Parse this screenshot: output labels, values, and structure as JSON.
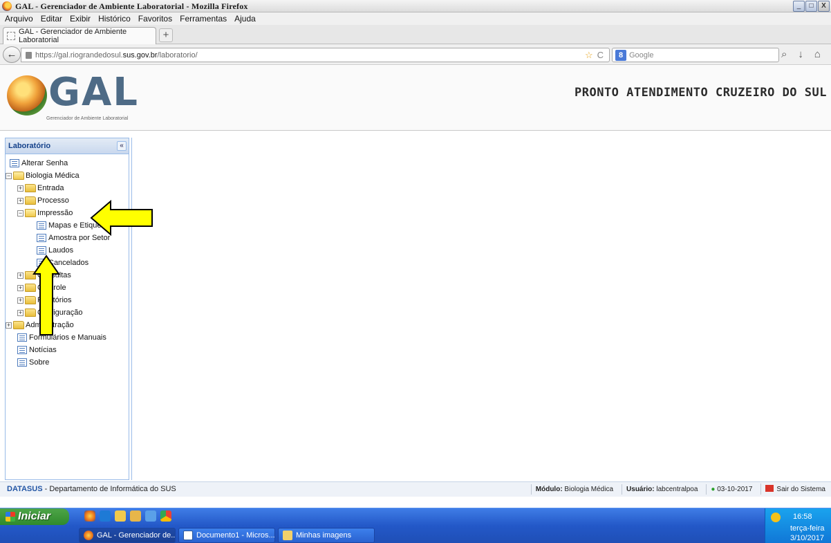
{
  "window": {
    "title": "GAL - Gerenciador de Ambiente Laboratorial - Mozilla Firefox",
    "controls": [
      "_",
      "□",
      "X"
    ]
  },
  "menu": [
    "Arquivo",
    "Editar",
    "Exibir",
    "Histórico",
    "Favoritos",
    "Ferramentas",
    "Ajuda"
  ],
  "tab": {
    "label": "GAL - Gerenciador de Ambiente Laboratorial",
    "new": "+"
  },
  "nav": {
    "back": "←",
    "url_prefix": "https://gal.riograndedosul.",
    "url_host": "sus.gov.br",
    "url_path": "/laboratorio/",
    "search_placeholder": "Google",
    "search_engine": "8",
    "reload": "C",
    "download": "↓",
    "home": "⌂",
    "bookmark": "☆",
    "search": "⌕"
  },
  "header": {
    "logo_text": "GAL",
    "logo_subtitle": "Gerenciador de Ambiente Laboratorial",
    "unit_name": "PRONTO ATENDIMENTO CRUZEIRO DO SUL"
  },
  "sidebar": {
    "title": "Laboratório",
    "collapse": "«",
    "items": [
      {
        "label": "Alterar Senha",
        "type": "leaf"
      },
      {
        "label": "Biologia Médica",
        "type": "folder-open"
      },
      {
        "label": "Entrada",
        "type": "folder"
      },
      {
        "label": "Processo",
        "type": "folder"
      },
      {
        "label": "Impressão",
        "type": "folder-open"
      },
      {
        "label": "Mapas e Etiquetas",
        "type": "leaf"
      },
      {
        "label": "Amostra por Setor",
        "type": "leaf"
      },
      {
        "label": "Laudos",
        "type": "leaf"
      },
      {
        "label": "Cancelados",
        "type": "leaf"
      },
      {
        "label": "Consultas",
        "type": "folder"
      },
      {
        "label": "Controle",
        "type": "folder"
      },
      {
        "label": "Relatórios",
        "type": "folder"
      },
      {
        "label": "Configuração",
        "type": "folder"
      },
      {
        "label": "Administração",
        "type": "folder"
      },
      {
        "label": "Formulários e Manuais",
        "type": "leaf"
      },
      {
        "label": "Notícias",
        "type": "leaf"
      },
      {
        "label": "Sobre",
        "type": "leaf"
      }
    ]
  },
  "footer": {
    "org": "DATASUS",
    "org_desc": " - Departamento de Informática do SUS",
    "module_label": "Módulo:",
    "module_value": " Biologia Médica",
    "user_label": "Usuário:",
    "user_value": " labcentralpoa",
    "date": "03-10-2017",
    "exit": "Sair do Sistema"
  },
  "taskbar": {
    "start": "Iniciar",
    "tasks": [
      "GAL - Gerenciador de...",
      "Documento1 - Micros...",
      "Minhas imagens"
    ],
    "time": "16:58",
    "day": "terça-feira",
    "date": "3/10/2017"
  },
  "colors": {
    "annotation_arrow": "#ffff00",
    "sidebar_header": "#15428b",
    "footer_org": "#2255a4"
  }
}
